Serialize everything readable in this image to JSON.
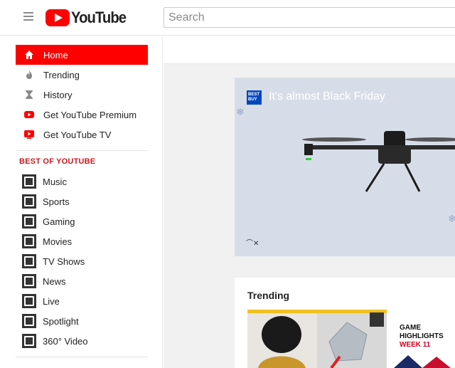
{
  "header": {
    "logo_text": "YouTube",
    "search_placeholder": "Search"
  },
  "sidebar": {
    "main_items": [
      {
        "label": "Home",
        "icon": "home-icon",
        "active": true
      },
      {
        "label": "Trending",
        "icon": "flame-icon"
      },
      {
        "label": "History",
        "icon": "hourglass-icon"
      },
      {
        "label": "Get YouTube Premium",
        "icon": "youtube-logo-icon"
      },
      {
        "label": "Get YouTube TV",
        "icon": "youtube-tv-icon"
      }
    ],
    "section_title": "BEST OF YOUTUBE",
    "best_items": [
      {
        "label": "Music"
      },
      {
        "label": "Sports"
      },
      {
        "label": "Gaming"
      },
      {
        "label": "Movies"
      },
      {
        "label": "TV Shows"
      },
      {
        "label": "News"
      },
      {
        "label": "Live"
      },
      {
        "label": "Spotlight"
      },
      {
        "label": "360° Video"
      }
    ]
  },
  "banner": {
    "logo_text": "BEST BUY",
    "title": "It's almost Black Friday",
    "colors": {
      "background": "#d7dde8",
      "brand": "#0046be"
    }
  },
  "trending": {
    "title": "Trending",
    "thumb2_lines": [
      "GAME",
      "HIGHLIGHTS",
      "WEEK 11"
    ]
  },
  "colors": {
    "accent": "#ff0000",
    "section_title": "#cc181e",
    "main_bg": "#f1f1f1"
  }
}
